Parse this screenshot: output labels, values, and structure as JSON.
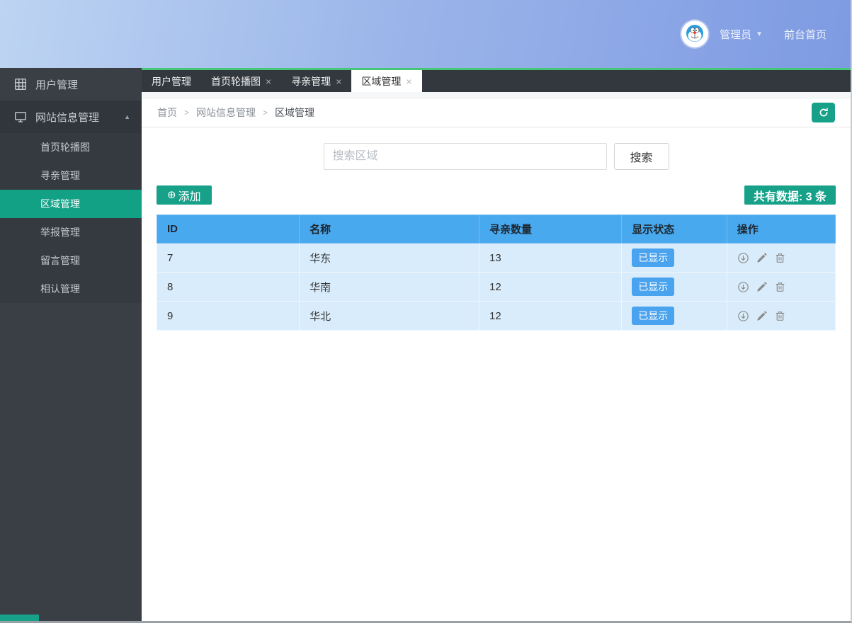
{
  "header": {
    "admin_label": "管理员",
    "caret": "▼",
    "frontend_link": "前台首页"
  },
  "sidebar": {
    "items": [
      {
        "label": "用户管理",
        "icon": "grid-icon"
      },
      {
        "label": "网站信息管理",
        "icon": "monitor-icon",
        "expanded": true
      }
    ],
    "expand_caret": "▲",
    "submenu": [
      "首页轮播图",
      "寻亲管理",
      "区域管理",
      "举报管理",
      "留言管理",
      "相认管理"
    ],
    "active_submenu": "区域管理"
  },
  "tabs": [
    {
      "label": "用户管理",
      "closable": false
    },
    {
      "label": "首页轮播图",
      "closable": true
    },
    {
      "label": "寻亲管理",
      "closable": true
    },
    {
      "label": "区域管理",
      "closable": true,
      "active": true
    }
  ],
  "tab_close_glyph": "×",
  "breadcrumb": {
    "items": [
      "首页",
      "网站信息管理",
      "区域管理"
    ],
    "separator": ">"
  },
  "toolbar": {
    "search_placeholder": "搜索区域",
    "search_button": "搜索",
    "add_icon": "⊕",
    "add_label": "添加",
    "total_label": "共有数据: 3 条"
  },
  "table": {
    "headers": [
      "ID",
      "名称",
      "寻亲数量",
      "显示状态",
      "操作"
    ],
    "rows": [
      {
        "id": "7",
        "name": "华东",
        "count": "13",
        "status": "已显示"
      },
      {
        "id": "8",
        "name": "华南",
        "count": "12",
        "status": "已显示"
      },
      {
        "id": "9",
        "name": "华北",
        "count": "12",
        "status": "已显示"
      }
    ],
    "action_icons": [
      "circle-down-icon",
      "pencil-icon",
      "trash-icon"
    ]
  },
  "colors": {
    "accent_teal": "#17a189",
    "tab_line_green": "#45c777",
    "table_header_blue": "#49a9ee",
    "status_badge_blue": "#4aa3ee",
    "sidebar_dark": "#3a3f45"
  }
}
